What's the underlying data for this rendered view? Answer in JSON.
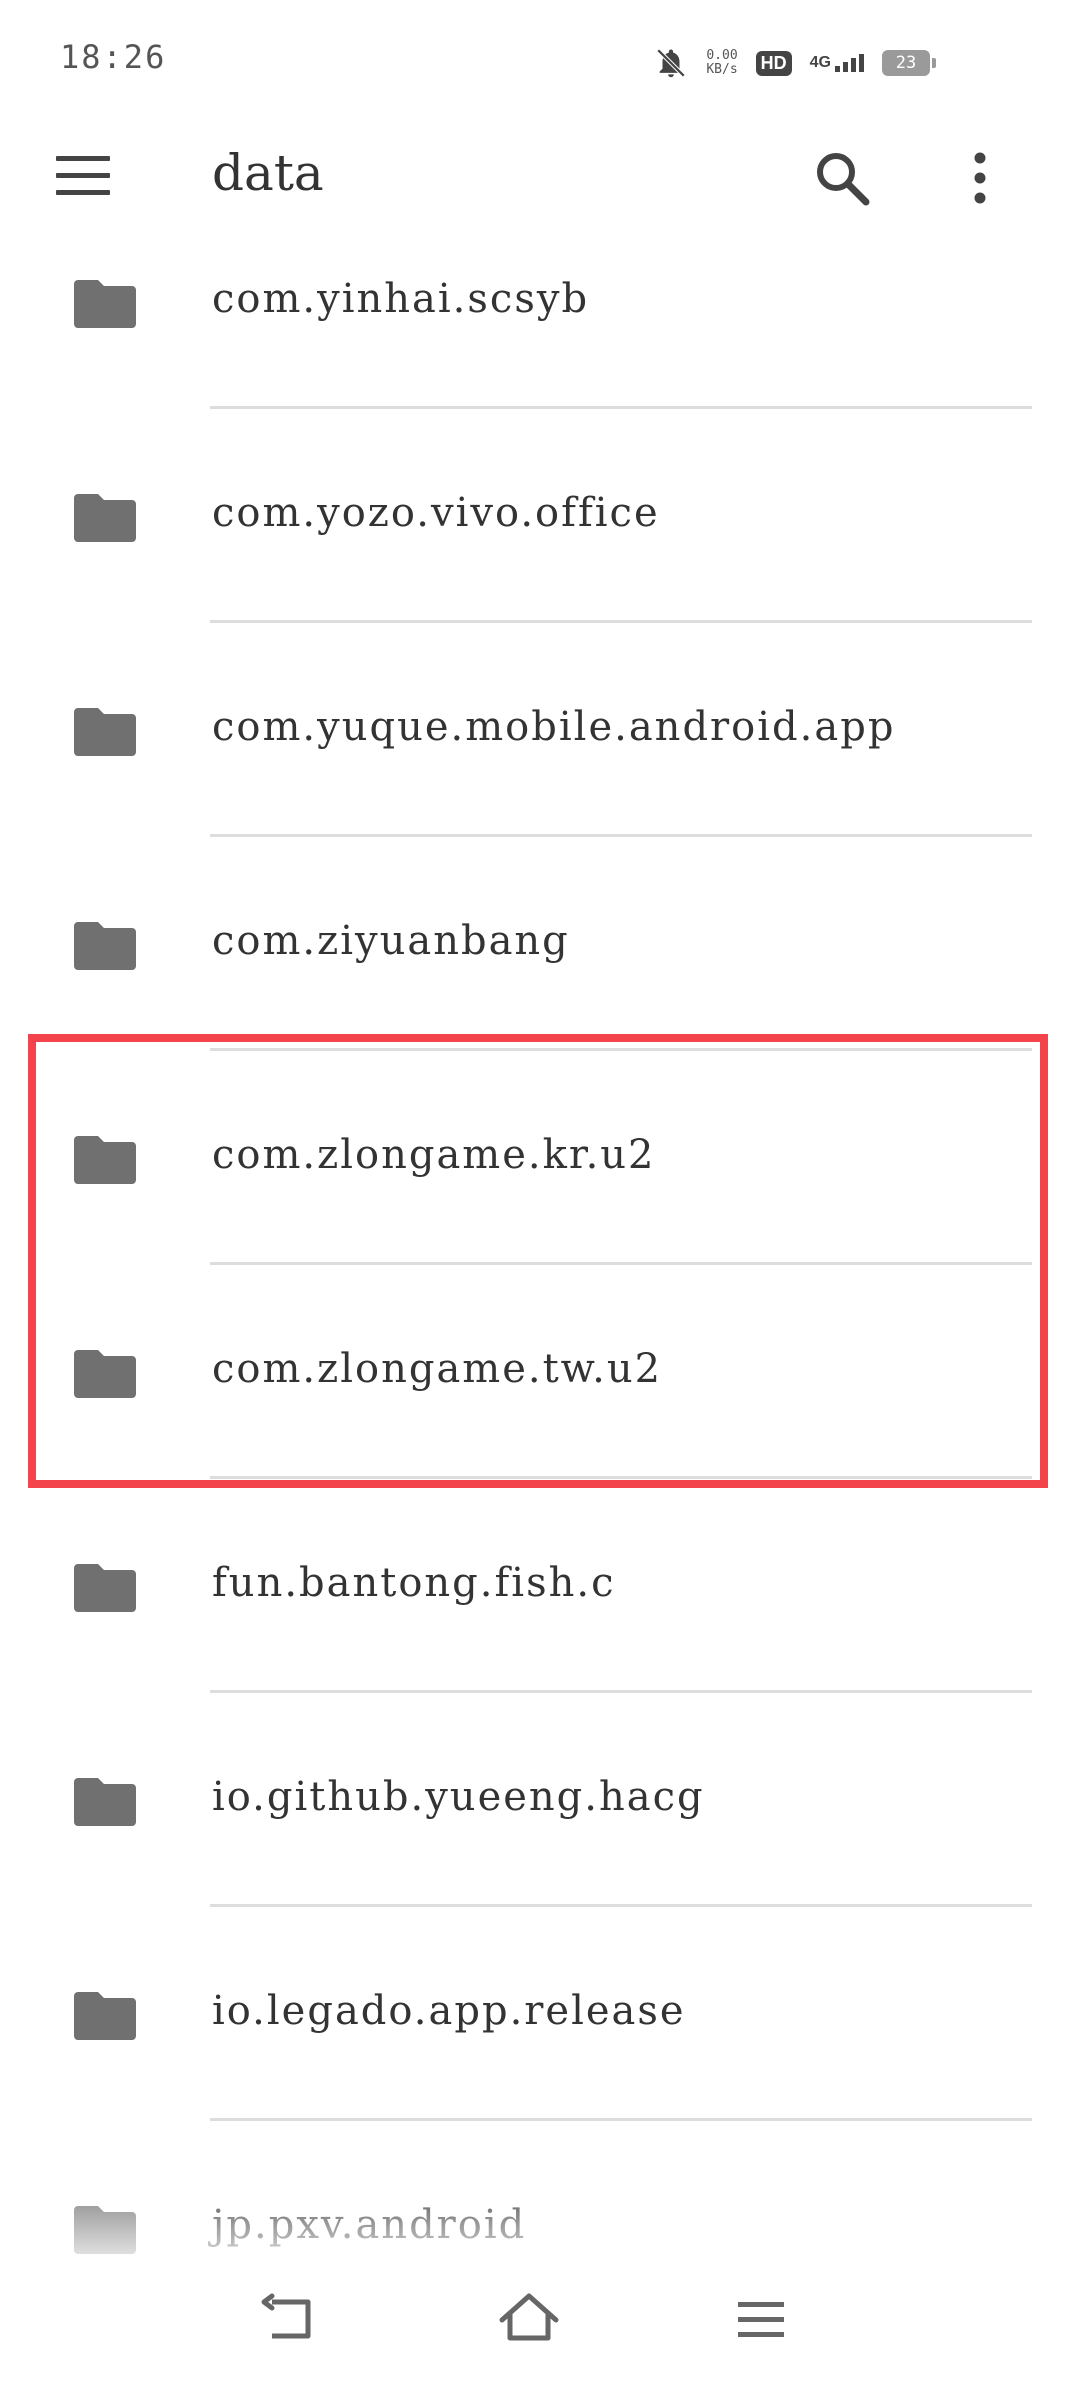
{
  "status_bar": {
    "time": "18:26",
    "net_speed_value": "0.00",
    "net_speed_unit": "KB/s",
    "hd_label": "HD",
    "network_type": "4G",
    "battery_level": "23",
    "icons": [
      "mute-bell-icon",
      "hd-icon",
      "signal-icon",
      "battery-icon"
    ]
  },
  "app_bar": {
    "title": "data",
    "icons": [
      "hamburger-menu-icon",
      "search-icon",
      "more-vert-icon"
    ]
  },
  "folders": [
    {
      "name": "com.yinhai.scsyb"
    },
    {
      "name": "com.yozo.vivo.office"
    },
    {
      "name": "com.yuque.mobile.android.app"
    },
    {
      "name": "com.ziyuanbang"
    },
    {
      "name": "com.zlongame.kr.u2"
    },
    {
      "name": "com.zlongame.tw.u2"
    },
    {
      "name": "fun.bantong.fish.c"
    },
    {
      "name": "io.github.yueeng.hacg"
    },
    {
      "name": "io.legado.app.release"
    },
    {
      "name": "jp.pxv.android"
    }
  ],
  "colors": {
    "highlight_border": "#f2444a",
    "folder_icon": "#707070",
    "divider": "#dddddd",
    "text": "#333333"
  },
  "nav_bar": {
    "icons": [
      "back-icon",
      "home-icon",
      "recents-menu-icon"
    ]
  }
}
